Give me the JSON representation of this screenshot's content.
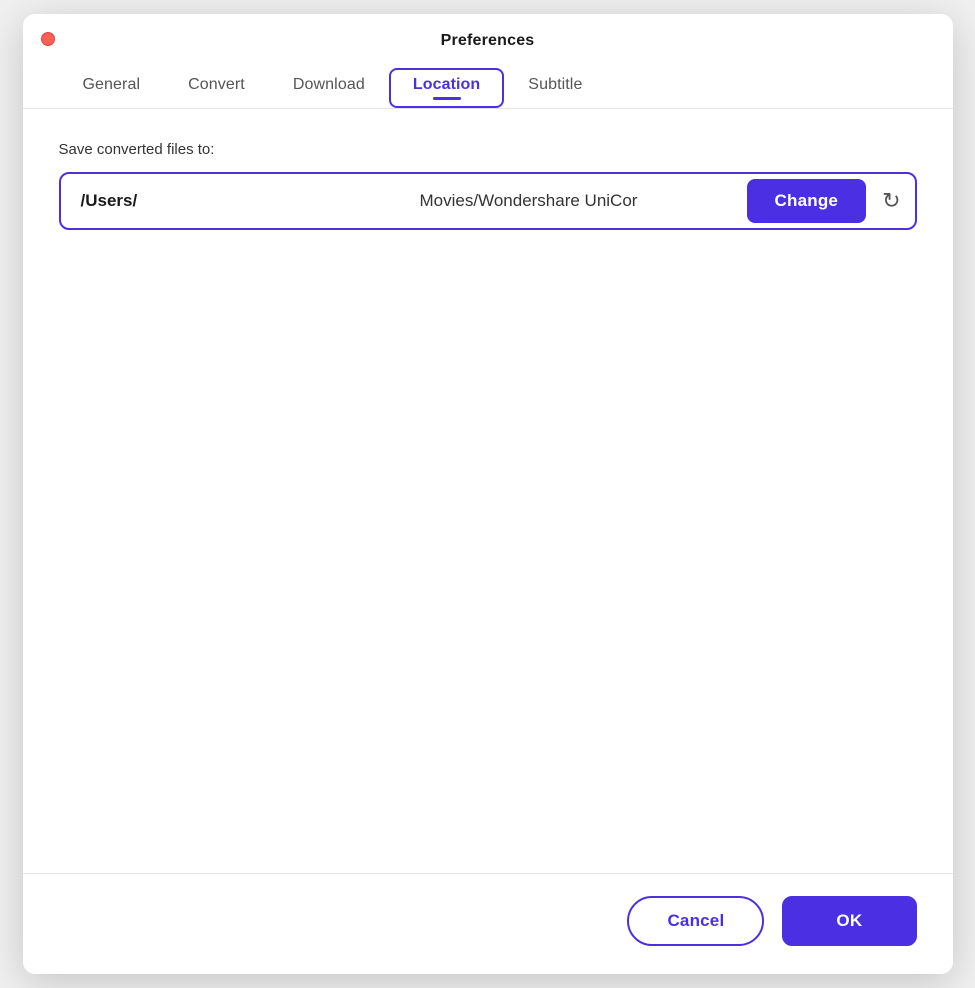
{
  "window": {
    "title": "Preferences",
    "accent_color": "#4b30e3"
  },
  "tabs": [
    {
      "id": "general",
      "label": "General",
      "active": false
    },
    {
      "id": "convert",
      "label": "Convert",
      "active": false
    },
    {
      "id": "download",
      "label": "Download",
      "active": false
    },
    {
      "id": "location",
      "label": "Location",
      "active": true
    },
    {
      "id": "subtitle",
      "label": "Subtitle",
      "active": false
    }
  ],
  "location_section": {
    "label": "Save converted files to:",
    "path_left": "/Users/",
    "path_right": "Movies/Wondershare UniCor",
    "change_button": "Change",
    "refresh_icon": "↻"
  },
  "footer": {
    "cancel_label": "Cancel",
    "ok_label": "OK"
  }
}
